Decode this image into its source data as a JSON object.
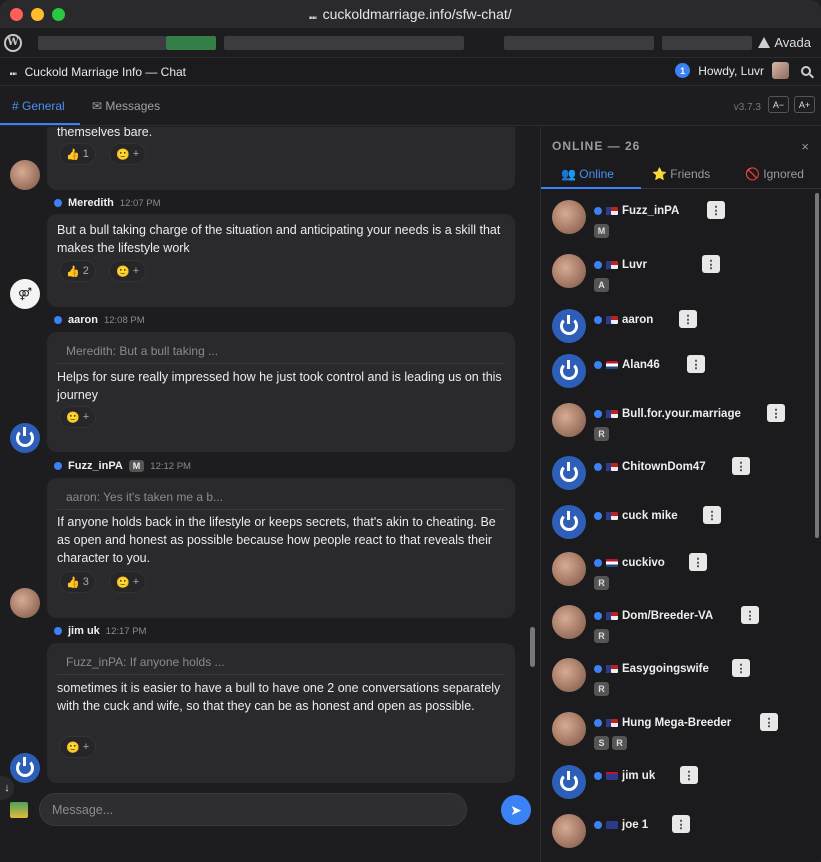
{
  "browser": {
    "url": "cuckoldmarriage.info/sfw-chat/"
  },
  "wpbar": {
    "avada_label": "Avada"
  },
  "chatbar": {
    "title": "Cuckold Marriage Info — Chat",
    "notif_count": "1",
    "howdy": "Howdy, Luvr"
  },
  "tabs": {
    "general": "# General",
    "messages": "✉ Messages",
    "version": "v3.7.3",
    "font_down": "A−",
    "font_up": "A+"
  },
  "messages": [
    {
      "text": "themselves bare.",
      "reactions": [
        {
          "emoji": "👍",
          "count": "1"
        },
        {
          "emoji": "🙂",
          "count": "+"
        }
      ]
    },
    {
      "author": "Meredith",
      "time": "12:07 PM",
      "text": "But a bull taking charge of the situation and anticipating your needs is a skill that makes the lifestyle work",
      "reactions": [
        {
          "emoji": "👍",
          "count": "2"
        },
        {
          "emoji": "🙂",
          "count": "+"
        }
      ]
    },
    {
      "author": "aaron",
      "time": "12:08 PM",
      "quote": "Meredith: But a bull taking ...",
      "text": "Helps for sure really impressed how he just took control and is leading us on this journey",
      "reactions": [
        {
          "emoji": "🙂",
          "count": "+"
        }
      ]
    },
    {
      "author": "Fuzz_inPA",
      "badge": "M",
      "time": "12:12 PM",
      "quote": "aaron: Yes it's taken me a b...",
      "text": "If anyone holds back in the lifestyle or keeps secrets, that's akin to cheating. Be as open and honest as possible because how people react to that reveals their character to you.",
      "reactions": [
        {
          "emoji": "👍",
          "count": "3"
        },
        {
          "emoji": "🙂",
          "count": "+"
        }
      ]
    },
    {
      "author": "jim uk",
      "time": "12:17 PM",
      "quote": "Fuzz_inPA: If anyone holds ...",
      "text": "sometimes it is easier to have a bull to have one 2 one conversations separately with the cuck and wife, so that they can be as honest and open as possible.",
      "reactions": [
        {
          "emoji": "🙂",
          "count": "+"
        }
      ]
    }
  ],
  "input": {
    "placeholder": "Message..."
  },
  "side": {
    "header": "ONLINE — 26",
    "close": "×",
    "tab_online": "👥 Online",
    "tab_friends": "⭐ Friends",
    "tab_ignored": "🚫 Ignored",
    "users": [
      {
        "name": "Fuzz_inPA",
        "flag": "us",
        "roles": [
          "M"
        ],
        "avatar": "photo"
      },
      {
        "name": "Luvr",
        "flag": "us",
        "roles": [
          "A"
        ],
        "avatar": "photo"
      },
      {
        "name": "aaron",
        "flag": "us",
        "roles": [],
        "avatar": "default"
      },
      {
        "name": "Alan46",
        "flag": "nl",
        "roles": [],
        "avatar": "default"
      },
      {
        "name": "Bull.for.your.marriage",
        "flag": "us",
        "roles": [
          "R"
        ],
        "avatar": "photo"
      },
      {
        "name": "ChitownDom47",
        "flag": "us",
        "roles": [],
        "avatar": "default"
      },
      {
        "name": "cuck mike",
        "flag": "us",
        "roles": [],
        "avatar": "default"
      },
      {
        "name": "cuckivo",
        "flag": "nl",
        "roles": [
          "R"
        ],
        "avatar": "photo"
      },
      {
        "name": "Dom/Breeder-VA",
        "flag": "us",
        "roles": [
          "R"
        ],
        "avatar": "photo"
      },
      {
        "name": "Easygoingswife",
        "flag": "us",
        "roles": [
          "R"
        ],
        "avatar": "photo"
      },
      {
        "name": "Hung Mega-Breeder",
        "flag": "us",
        "roles": [
          "S",
          "R"
        ],
        "avatar": "photo"
      },
      {
        "name": "jim uk",
        "flag": "gb",
        "roles": [],
        "avatar": "default"
      },
      {
        "name": "joe 1",
        "flag": "nz",
        "roles": [],
        "avatar": "photo"
      }
    ]
  },
  "colors": {
    "accent": "#3b82f6",
    "bubble": "#2a2a2d",
    "background": "#1d1d1f"
  }
}
